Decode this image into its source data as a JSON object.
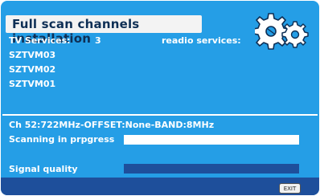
{
  "header": {
    "title": "Full scan channels installation",
    "icon": "gears-icon"
  },
  "services": {
    "tv_label": "TV Services:",
    "tv_count": "3",
    "radio_label": "readio services:",
    "channels": [
      "SZTVM03",
      "SZTVM02",
      "SZTVM01"
    ]
  },
  "scan": {
    "channel_info": "Ch 52:722MHz-OFFSET:None-BAND:8MHz",
    "progress_label": "Scanning in prpgress",
    "signal_label": "Signal quality"
  },
  "footer": {
    "exit_label": "EXIT"
  },
  "colors": {
    "panel_blue": "#259ee6",
    "footer_blue": "#1e4f9b",
    "title_text": "#0e2f55"
  }
}
